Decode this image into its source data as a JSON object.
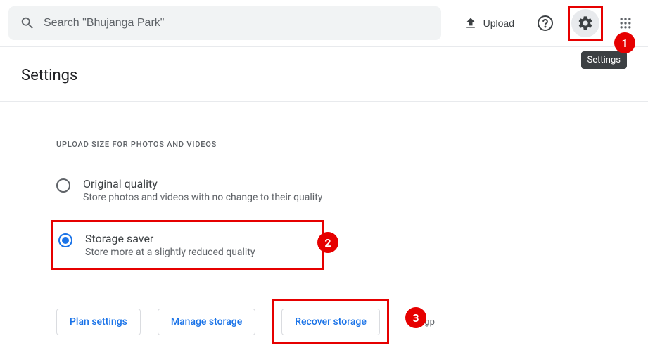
{
  "header": {
    "search_placeholder": "Search \"Bhujanga Park\"",
    "upload_label": "Upload",
    "tooltip": "Settings"
  },
  "page": {
    "title": "Settings",
    "section_label": "UPLOAD SIZE FOR PHOTOS AND VIDEOS"
  },
  "options": {
    "original": {
      "title": "Original quality",
      "desc": "Store photos and videos with no change to their quality"
    },
    "saver": {
      "title": "Storage saver",
      "desc": "Store more at a slightly reduced quality"
    }
  },
  "buttons": {
    "plan": "Plan settings",
    "manage": "Manage storage",
    "recover": "Recover storage"
  },
  "footer": {
    "copyright": "©tgp"
  },
  "callouts": {
    "one": "1",
    "two": "2",
    "three": "3"
  }
}
